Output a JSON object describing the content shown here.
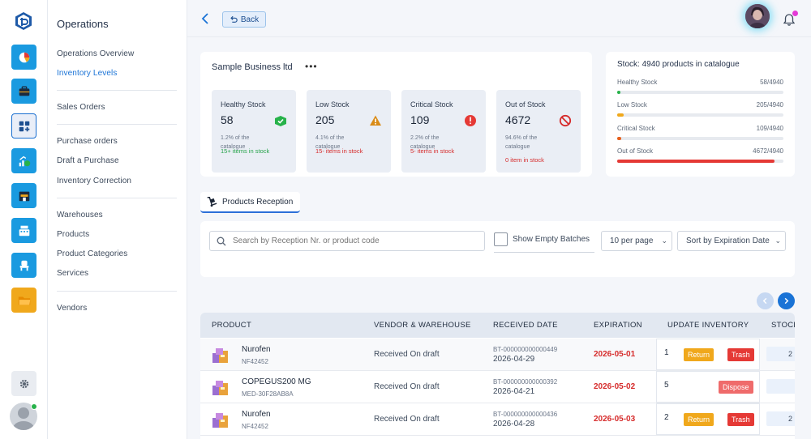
{
  "sidebar": {
    "title": "Operations",
    "groups": [
      [
        "Operations Overview",
        "Inventory Levels"
      ],
      [
        "Sales Orders"
      ],
      [
        "Purchase orders",
        "Draft a Purchase",
        "Inventory Correction"
      ],
      [
        "Warehouses",
        "Products",
        "Product Categories",
        "Services"
      ],
      [
        "Vendors"
      ]
    ],
    "active_item": "Inventory Levels"
  },
  "rail": {
    "icons": [
      "logo-icon",
      "pie-chart-icon",
      "briefcase-icon",
      "dashboard-add-icon",
      "growth-money-icon",
      "store-icon",
      "cash-register-icon",
      "chair-icon",
      "folder-icon",
      "settings-icon",
      "user-avatar-icon"
    ],
    "accent": "#1a9ae0"
  },
  "topbar": {
    "back_label": "Back"
  },
  "business": {
    "name": "Sample Business ltd",
    "more": "•••",
    "stats": [
      {
        "title": "Healthy Stock",
        "value": "58",
        "percent": "1.2% of the catalogue",
        "foot": "15+ items in stock",
        "foot_color": "#27a34b",
        "icon": "box-check-icon"
      },
      {
        "title": "Low Stock",
        "value": "205",
        "percent": "4.1% of the catalogue",
        "foot": "15- items in stock",
        "foot_color": "#d62b2b",
        "icon": "warning-triangle-icon"
      },
      {
        "title": "Critical Stock",
        "value": "109",
        "percent": "2.2% of the catalogue",
        "foot": "5- items in stock",
        "foot_color": "#d62b2b",
        "icon": "alert-circle-icon"
      },
      {
        "title": "Out of Stock",
        "value": "4672",
        "percent": "94.6% of the catalogue",
        "foot": "0 item in stock",
        "foot_color": "#d62b2b",
        "icon": "no-entry-icon"
      }
    ]
  },
  "stock": {
    "title": "Stock: 4940 products in catalogue",
    "rows": [
      {
        "label": "Healthy Stock",
        "value": "58/4940",
        "fraction": 0.012,
        "color": "#27b24a"
      },
      {
        "label": "Low Stock",
        "value": "205/4940",
        "fraction": 0.041,
        "color": "#f0a81c"
      },
      {
        "label": "Critical Stock",
        "value": "109/4940",
        "fraction": 0.022,
        "color": "#e8601c"
      },
      {
        "label": "Out of Stock",
        "value": "4672/4940",
        "fraction": 0.946,
        "color": "#e53935"
      }
    ]
  },
  "tab": {
    "label": "Products Reception"
  },
  "filters": {
    "search_placeholder": "Search by Reception Nr. or product code",
    "checkbox_label": "Show Empty Batches",
    "per_page": "10 per page",
    "sort": "Sort by Expiration Date"
  },
  "table": {
    "headers": [
      "PRODUCT",
      "VENDOR & WAREHOUSE",
      "RECEIVED DATE",
      "EXPIRATION",
      "UPDATE INVENTORY",
      "STOCK"
    ],
    "rows": [
      {
        "name": "Nurofen",
        "code": "NF42452",
        "vendor": "Received On draft",
        "batch": "BT-000000000000449",
        "received": "2026-04-29",
        "expiration": "2026-05-01",
        "qty": "1",
        "actions": [
          "Return",
          "Trash"
        ],
        "stock": "2"
      },
      {
        "name": "COPEGUS200 MG",
        "code": "MED-30F28AB8A",
        "vendor": "Received On draft",
        "batch": "BT-000000000000392",
        "received": "2026-04-21",
        "expiration": "2026-05-02",
        "qty": "5",
        "actions": [
          "Dispose"
        ],
        "stock": ""
      },
      {
        "name": "Nurofen",
        "code": "NF42452",
        "vendor": "Received On draft",
        "batch": "BT-000000000000436",
        "received": "2026-04-28",
        "expiration": "2026-05-03",
        "qty": "2",
        "actions": [
          "Return",
          "Trash"
        ],
        "stock": "2"
      }
    ]
  }
}
